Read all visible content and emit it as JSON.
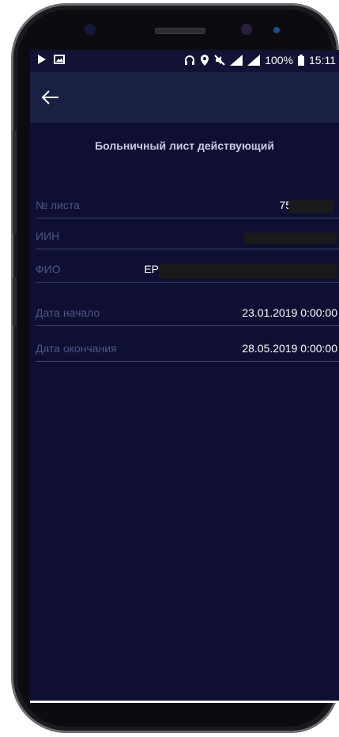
{
  "status_bar": {
    "battery": "100%",
    "time": "15:11"
  },
  "header": {
    "back_label": "←"
  },
  "title": "Больничный лист действующий",
  "fields": [
    {
      "label": "№ листа",
      "value": "75"
    },
    {
      "label": "ИИН",
      "value": ""
    },
    {
      "label": "ФИО",
      "value": "ЕР"
    },
    {
      "label": "Дата начало",
      "value": "23.01.2019 0:00:00"
    },
    {
      "label": "Дата окончания",
      "value": "28.05.2019 0:00:00"
    }
  ]
}
